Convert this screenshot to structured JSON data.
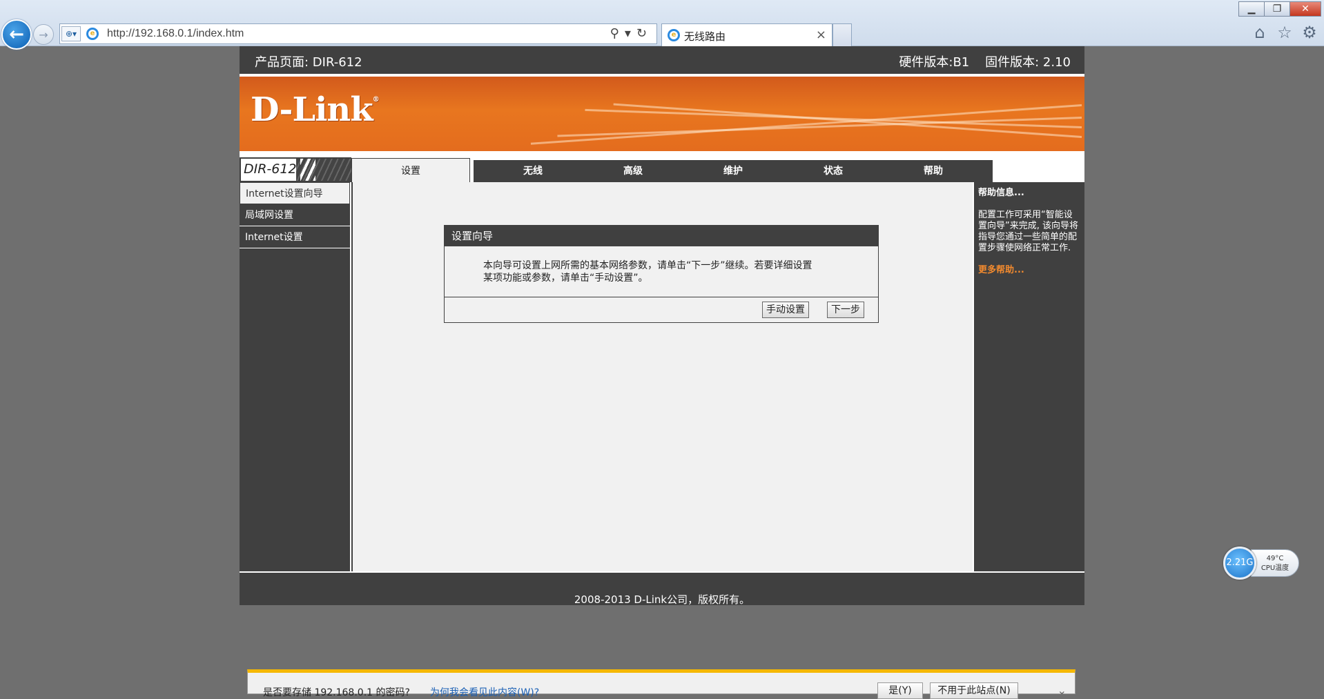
{
  "browser": {
    "url": "http://192.168.0.1/index.htm",
    "tab_title": "无线路由",
    "window_buttons": {
      "minimize": "▁",
      "restore": "❐",
      "close": "✕"
    }
  },
  "header": {
    "product": "产品页面: DIR-612",
    "version": "硬件版本:B1    固件版本: 2.10"
  },
  "brand": {
    "logo": "D-Link",
    "mark": "®"
  },
  "model": "DIR-612",
  "tabs": [
    {
      "label": "设置",
      "active": true
    },
    {
      "label": "无线"
    },
    {
      "label": "高级"
    },
    {
      "label": "维护"
    },
    {
      "label": "状态"
    },
    {
      "label": "帮助"
    }
  ],
  "sidebar": [
    {
      "label": "Internet设置向导",
      "active": true
    },
    {
      "label": "局域网设置"
    },
    {
      "label": "Internet设置"
    }
  ],
  "wizard": {
    "title": "设置向导",
    "line1": "本向导可设置上网所需的基本网络参数，请单击“下一步”继续。若要详细设置",
    "line2": "某项功能或参数，请单击“手动设置”。",
    "manual_btn": "手动设置",
    "next_btn": "下一步"
  },
  "help": {
    "title": "帮助信息...",
    "text": "配置工作可采用“智能设置向导”来完成, 该向导将指导您通过一些简单的配置步骤使网络正常工作.",
    "more": "更多帮助..."
  },
  "footer": "2008-2013 D-Link公司，版权所有。",
  "cpu_widget": {
    "freq": "2.21G",
    "temp": "49°C",
    "label": "CPU温度"
  },
  "notification": {
    "text": "是否要存储 192.168.0.1 的密码?",
    "link": "为何我会看见此内容(W)?",
    "yes": "是(Y)",
    "never": "不用于此站点(N)"
  },
  "colors": {
    "accent": "#e8761f",
    "dark": "#404040",
    "link": "#f28a2e"
  }
}
